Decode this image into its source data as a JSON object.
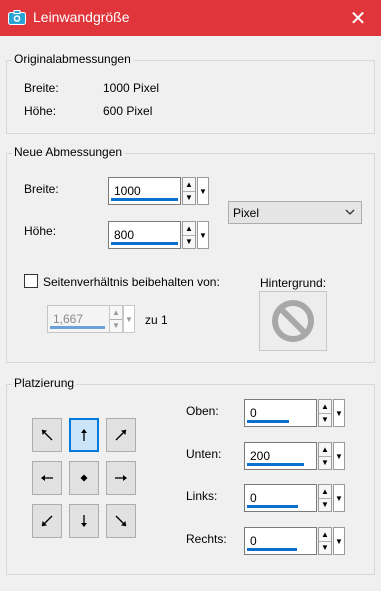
{
  "window": {
    "title": "Leinwandgröße",
    "close_glyph": "✕"
  },
  "original": {
    "legend": "Originalabmessungen",
    "width_label": "Breite:",
    "width_value": "1000 Pixel",
    "height_label": "Höhe:",
    "height_value": "600 Pixel"
  },
  "new": {
    "legend": "Neue Abmessungen",
    "width_label": "Breite:",
    "width_value": "1000",
    "height_label": "Höhe:",
    "height_value": "800",
    "unit": "Pixel",
    "keep_ratio_label": "Seitenverhältnis beibehalten von:",
    "keep_ratio_checked": false,
    "ratio_value": "1,667",
    "ratio_suffix": "zu 1",
    "background_label": "Hintergrund:"
  },
  "placement": {
    "legend": "Platzierung",
    "selected": "top",
    "top_label": "Oben:",
    "top_value": "0",
    "bottom_label": "Unten:",
    "bottom_value": "200",
    "left_label": "Links:",
    "left_value": "0",
    "right_label": "Rechts:",
    "right_value": "0"
  }
}
